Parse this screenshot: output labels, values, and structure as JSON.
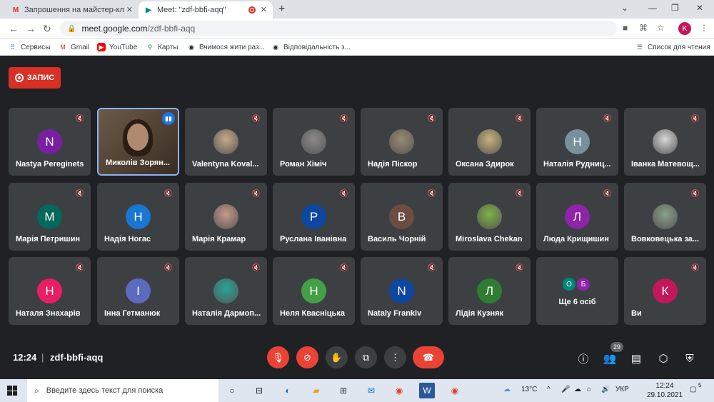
{
  "browser": {
    "tabs": [
      {
        "title": "Запрошення на майстер-клас с",
        "icon": "gmail-icon"
      },
      {
        "title": "Meet: \"zdf-bbfi-aqq\"",
        "icon": "meet-icon"
      }
    ],
    "url_host": "meet.google.com",
    "url_path": "/zdf-bbfi-aqq",
    "profile_initial": "K",
    "bookmarks": [
      {
        "label": "Сервисы",
        "icon": "apps-icon"
      },
      {
        "label": "Gmail",
        "icon": "gmail-icon"
      },
      {
        "label": "YouTube",
        "icon": "youtube-icon"
      },
      {
        "label": "Карты",
        "icon": "maps-icon"
      },
      {
        "label": "Вчимося жити раз...",
        "icon": "site-icon"
      },
      {
        "label": "Відповідальність з...",
        "icon": "site-icon"
      }
    ],
    "reading_list": "Список для чтения"
  },
  "meet": {
    "record_label": "ЗАПИС",
    "meeting_code": "zdf-bbfi-aqq",
    "time": "12:24",
    "participant_count": "29",
    "more_label": "Ще 6 осіб",
    "participants": [
      {
        "name": "Nastya Pereginets",
        "initial": "N",
        "color": "#7b1fa2",
        "type": "letter"
      },
      {
        "name": "Миколів Зорян...",
        "initial": "",
        "color": "",
        "type": "video",
        "speaking": true
      },
      {
        "name": "Valentyna Koval...",
        "initial": "",
        "color": "#c7a98a",
        "type": "photo"
      },
      {
        "name": "Роман Хіміч",
        "initial": "",
        "color": "#8a8a8a",
        "type": "photo"
      },
      {
        "name": "Надія Піскор",
        "initial": "",
        "color": "#9a8a70",
        "type": "photo"
      },
      {
        "name": "Оксана Здирок",
        "initial": "",
        "color": "#c9b27a",
        "type": "photo"
      },
      {
        "name": "Наталія Рудниц...",
        "initial": "Н",
        "color": "#78909c",
        "type": "letter"
      },
      {
        "name": "Іванка Матевощ...",
        "initial": "",
        "color": "#d8d8d8",
        "type": "photo"
      },
      {
        "name": "Марія Петришин",
        "initial": "М",
        "color": "#00695c",
        "type": "letter"
      },
      {
        "name": "Надія Ногас",
        "initial": "Н",
        "color": "#1976d2",
        "type": "letter"
      },
      {
        "name": "Марія Крамар",
        "initial": "",
        "color": "#c89a8a",
        "type": "photo"
      },
      {
        "name": "Руслана Іванівна",
        "initial": "Р",
        "color": "#0d47a1",
        "type": "letter"
      },
      {
        "name": "Василь Чорній",
        "initial": "В",
        "color": "#6d4c41",
        "type": "letter"
      },
      {
        "name": "Miroslava Chekan",
        "initial": "",
        "color": "#7cb342",
        "type": "photo"
      },
      {
        "name": "Люда Крищишин",
        "initial": "Л",
        "color": "#8e24aa",
        "type": "letter"
      },
      {
        "name": "Вовковецька за...",
        "initial": "",
        "color": "#8aa08a",
        "type": "photo"
      },
      {
        "name": "Наталя Знахарів",
        "initial": "Н",
        "color": "#e91e63",
        "type": "letter"
      },
      {
        "name": "Інна Гетманюк",
        "initial": "І",
        "color": "#5c6bc0",
        "type": "letter"
      },
      {
        "name": "Наталія Дармоп...",
        "initial": "",
        "color": "#26a69a",
        "type": "photo"
      },
      {
        "name": "Неля Квасніцька",
        "initial": "Н",
        "color": "#43a047",
        "type": "letter"
      },
      {
        "name": "Nataly Frankiv",
        "initial": "N",
        "color": "#0d47a1",
        "type": "letter"
      },
      {
        "name": "Лідія Кузняк",
        "initial": "Л",
        "color": "#2e7d32",
        "type": "letter"
      },
      {
        "name": "",
        "initial": "",
        "color": "",
        "type": "more",
        "more_initials": [
          "О",
          "Б"
        ],
        "more_colors": [
          "#00897b",
          "#8e24aa"
        ]
      },
      {
        "name": "Ви",
        "initial": "К",
        "color": "#c2185b",
        "type": "letter"
      }
    ]
  },
  "taskbar": {
    "search_placeholder": "Введите здесь текст для поиска",
    "temperature": "13°C",
    "language": "УКР",
    "clock_time": "12:24",
    "clock_date": "29.10.2021",
    "notifications": "5"
  }
}
